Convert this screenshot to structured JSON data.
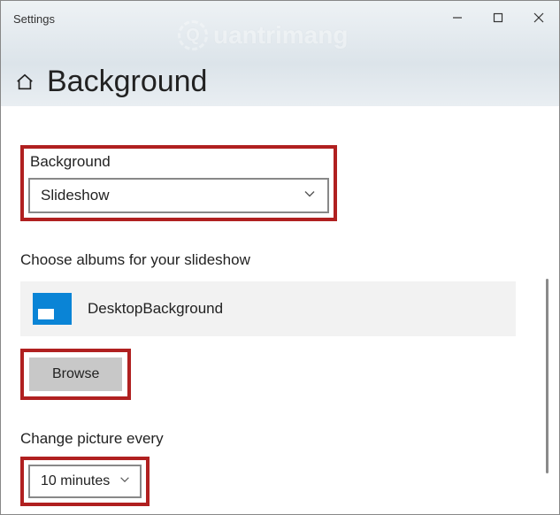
{
  "window": {
    "title": "Settings"
  },
  "watermark": "uantrimang",
  "page": {
    "heading": "Background"
  },
  "background": {
    "label": "Background",
    "selected": "Slideshow"
  },
  "albums": {
    "label": "Choose albums for your slideshow",
    "item_name": "DesktopBackground",
    "browse_label": "Browse"
  },
  "interval": {
    "label": "Change picture every",
    "selected": "10 minutes"
  }
}
